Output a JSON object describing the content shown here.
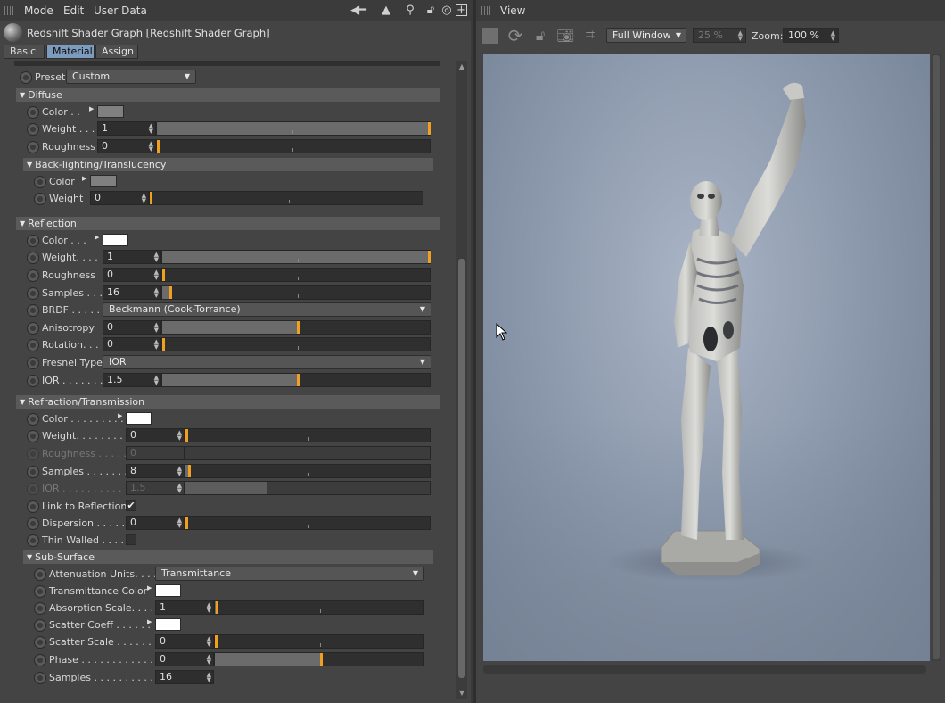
{
  "menubar": {
    "items": [
      "Mode",
      "Edit",
      "User Data"
    ]
  },
  "title": "Redshift Shader Graph [Redshift Shader Graph]",
  "tabs": [
    "Basic",
    "Material",
    "Assign"
  ],
  "preset": {
    "label": "Preset",
    "value": "Custom"
  },
  "diffuse": {
    "header": "Diffuse",
    "color_label": "Color . .",
    "color": "#808080",
    "weight_label": "Weight . . .",
    "weight": "1",
    "roughness_label": "Roughness",
    "roughness": "0",
    "backlighting": {
      "header": "Back-lighting/Translucency",
      "color_label": "Color",
      "color": "#808080",
      "weight_label": "Weight",
      "weight": "0"
    }
  },
  "reflection": {
    "header": "Reflection",
    "color_label": "Color . . .",
    "color": "#ffffff",
    "weight_label": "Weight. . . .",
    "weight": "1",
    "roughness_label": "Roughness",
    "roughness": "0",
    "samples_label": "Samples . . .",
    "samples": "16",
    "brdf_label": "BRDF . . . . .",
    "brdf": "Beckmann (Cook-Torrance)",
    "anisotropy_label": "Anisotropy",
    "anisotropy": "0",
    "rotation_label": "Rotation. . .",
    "rotation": "0",
    "fresnel_label": "Fresnel Type",
    "fresnel": "IOR",
    "ior_label": "IOR . . . . . . .",
    "ior": "1.5"
  },
  "refraction": {
    "header": "Refraction/Transmission",
    "color_label": "Color . . . . . . . . .",
    "color": "#ffffff",
    "weight_label": "Weight. . . . . . . . . .",
    "weight": "0",
    "roughness_label": "Roughness . . . . . .",
    "roughness": "0",
    "samples_label": "Samples . . . . . . . .",
    "samples": "8",
    "ior_label": "IOR . . . . . . . . . . . .",
    "ior": "1.5",
    "link_label": "Link to Reflection",
    "link_checked": "✔",
    "dispersion_label": "Dispersion . . . . . .",
    "dispersion": "0",
    "thin_label": "Thin Walled . . . . ."
  },
  "subsurface": {
    "header": "Sub-Surface",
    "atten_label": "Attenuation Units. . . .",
    "atten": "Transmittance",
    "trans_color_label": "Transmittance Color",
    "trans_color": "#ffffff",
    "absorption_label": "Absorption Scale. . . . .",
    "absorption": "1",
    "scatter_coeff_label": "Scatter Coeff . . . . . .",
    "scatter_coeff": "#ffffff",
    "scatter_scale_label": "Scatter Scale . . . . . . . .",
    "scatter_scale": "0",
    "phase_label": "Phase . . . . . . . . . . . . . .",
    "phase": "0",
    "samples_label": "Samples . . . . . . . . . . . .",
    "samples": "16"
  },
  "view": {
    "title": "View",
    "window_mode": "Full Window",
    "percent": "25 %",
    "zoom_label": "Zoom:",
    "zoom": "100 %"
  },
  "colors": {
    "accent": "#f0a020",
    "active_tab": "#7d9bbd"
  }
}
